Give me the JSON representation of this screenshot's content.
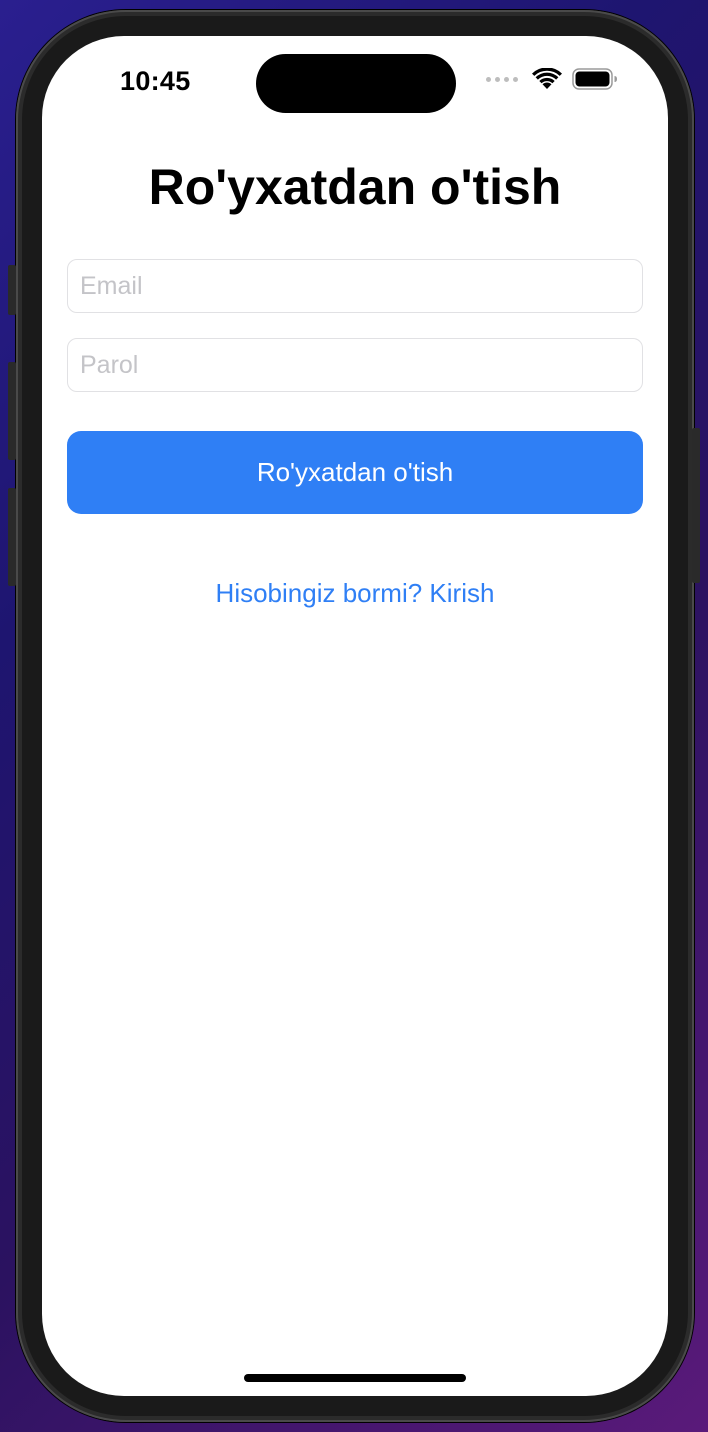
{
  "status_bar": {
    "time": "10:45"
  },
  "page": {
    "title": "Ro'yxatdan o'tish"
  },
  "form": {
    "email_placeholder": "Email",
    "email_value": "",
    "password_placeholder": "Parol",
    "password_value": "",
    "submit_label": "Ro'yxatdan o'tish"
  },
  "login_link": "Hisobingiz bormi? Kirish",
  "colors": {
    "accent": "#2f7ff5",
    "background": "#ffffff",
    "placeholder": "#c4c4c8"
  }
}
